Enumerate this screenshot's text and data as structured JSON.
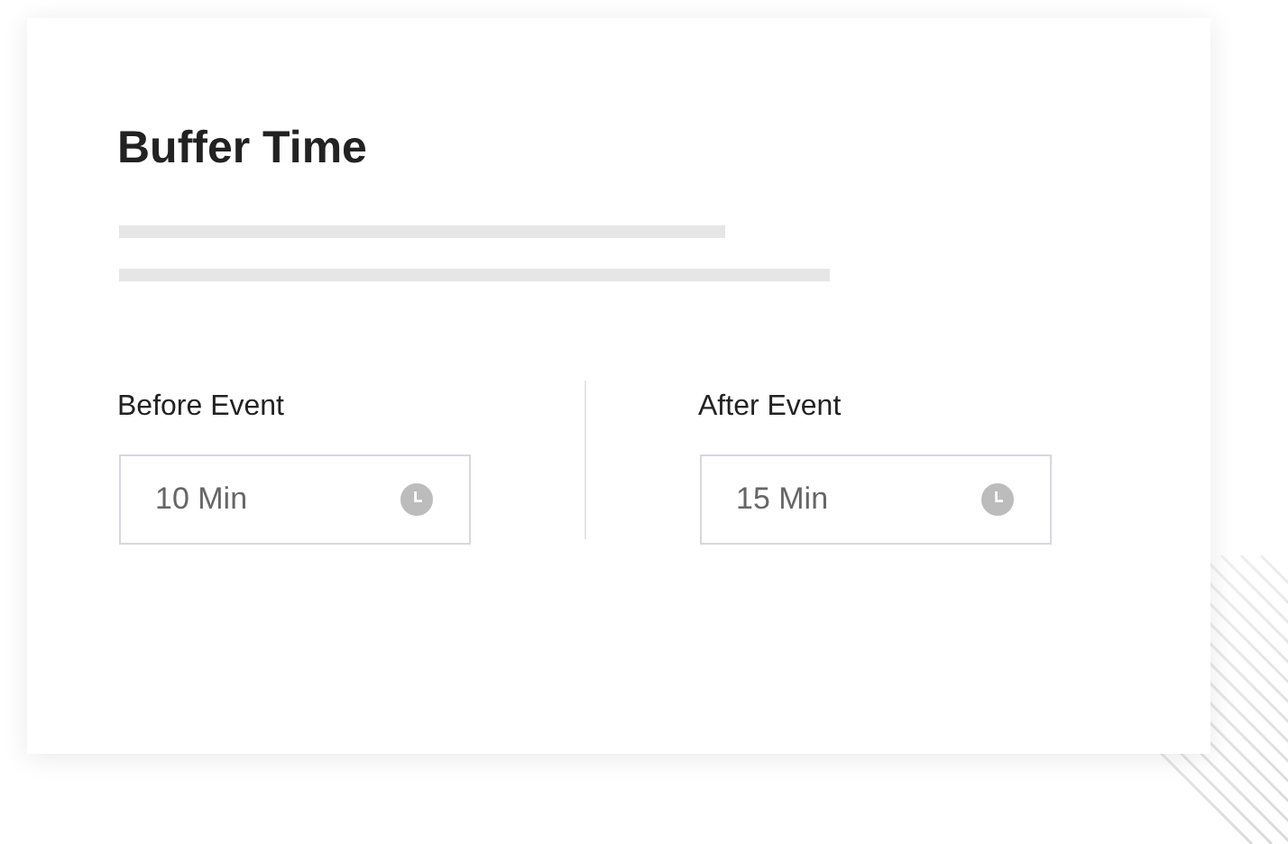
{
  "card": {
    "title": "Buffer Time",
    "fields": [
      {
        "label": "Before Event",
        "value": "10 Min"
      },
      {
        "label": "After Event",
        "value": "15 Min"
      }
    ]
  }
}
